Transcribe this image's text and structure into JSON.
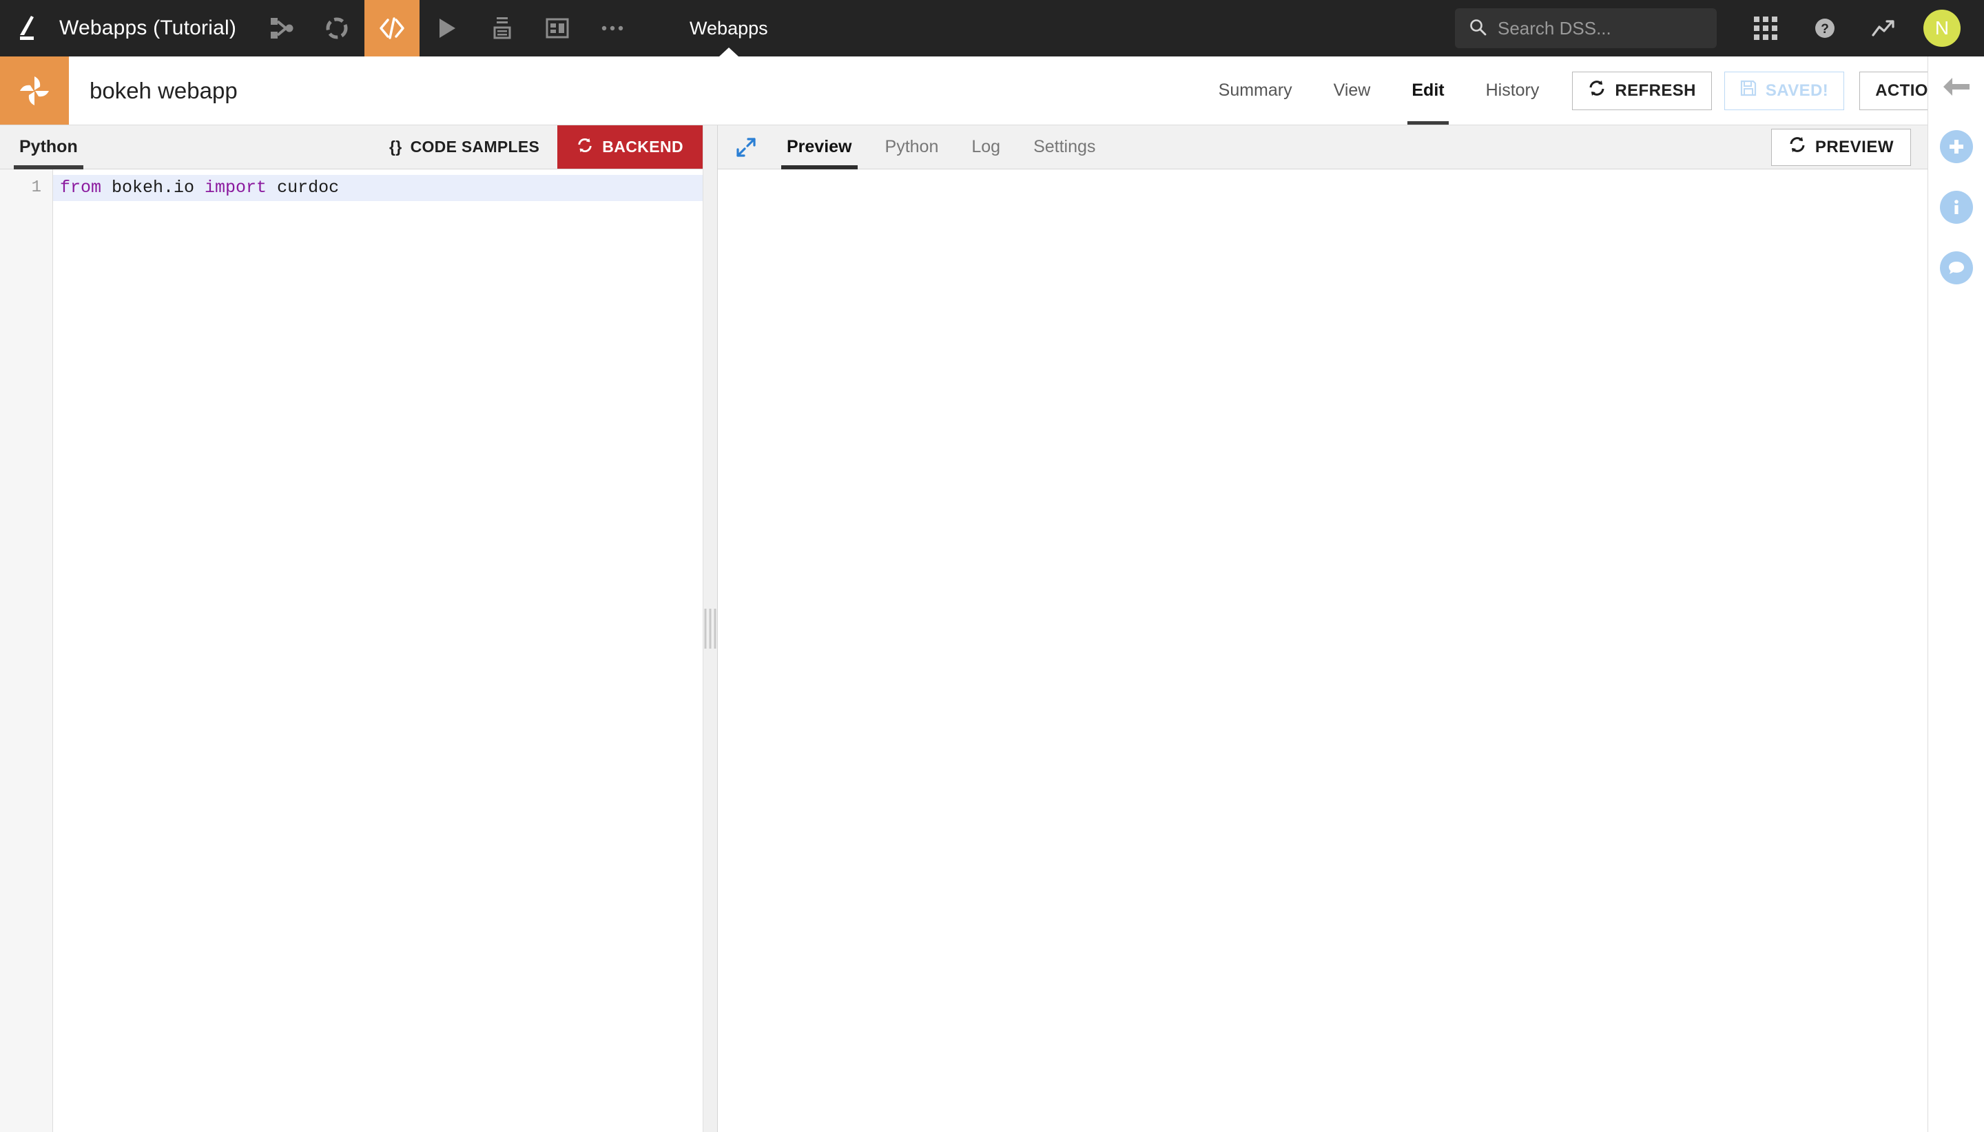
{
  "topnav": {
    "logo_icon": "dataiku-logo-icon",
    "project_title": "Webapps (Tutorial)",
    "icons": [
      {
        "name": "flow-icon",
        "label": "Flow"
      },
      {
        "name": "dashboard-circle-icon",
        "label": "Dashboards"
      },
      {
        "name": "code-icon",
        "label": "Code",
        "active": true
      },
      {
        "name": "play-icon",
        "label": "Jobs"
      },
      {
        "name": "lab-icon",
        "label": "Lab"
      },
      {
        "name": "layout-icon",
        "label": "Webapps"
      },
      {
        "name": "more-icon",
        "label": "More"
      }
    ],
    "section_label": "Webapps",
    "search": {
      "placeholder": "Search DSS...",
      "value": ""
    },
    "apps_icon": "apps-grid-icon",
    "help_icon": "help-icon",
    "activity_icon": "activity-trend-icon",
    "avatar_initial": "N",
    "avatar_color": "#d6e04f",
    "background_color": "#242424",
    "active_color": "#e8954a"
  },
  "subheader": {
    "app_icon": "webapp-shutter-icon",
    "app_title": "bokeh webapp",
    "tabs": [
      {
        "label": "Summary",
        "active": false
      },
      {
        "label": "View",
        "active": false
      },
      {
        "label": "Edit",
        "active": true
      },
      {
        "label": "History",
        "active": false
      }
    ],
    "refresh_label": "REFRESH",
    "saved_label": "SAVED!",
    "actions_label": "ACTIONS"
  },
  "right_rail": {
    "back_icon": "back-arrow-icon",
    "items": [
      {
        "name": "add-icon",
        "glyph": "+"
      },
      {
        "name": "info-icon",
        "glyph": "i"
      },
      {
        "name": "discussions-icon",
        "glyph": "chat"
      }
    ],
    "accent_color": "#a8cdf0"
  },
  "editor": {
    "tab_label": "Python",
    "code_samples_label": "CODE SAMPLES",
    "code_samples_prefix": "{}",
    "backend_label": "BACKEND",
    "backend_color": "#c0272d",
    "lines": [
      {
        "number": "1",
        "tokens": [
          {
            "t": "from",
            "type": "kw"
          },
          {
            "t": " bokeh.io ",
            "type": "plain"
          },
          {
            "t": "import",
            "type": "kw"
          },
          {
            "t": " curdoc",
            "type": "plain"
          }
        ],
        "plain": "from bokeh.io import curdoc"
      }
    ]
  },
  "preview": {
    "expand_icon": "expand-diagonal-icon",
    "tabs": [
      {
        "label": "Preview",
        "active": true
      },
      {
        "label": "Python",
        "active": false
      },
      {
        "label": "Log",
        "active": false
      },
      {
        "label": "Settings",
        "active": false
      }
    ],
    "preview_button_label": "PREVIEW",
    "body_content": ""
  }
}
